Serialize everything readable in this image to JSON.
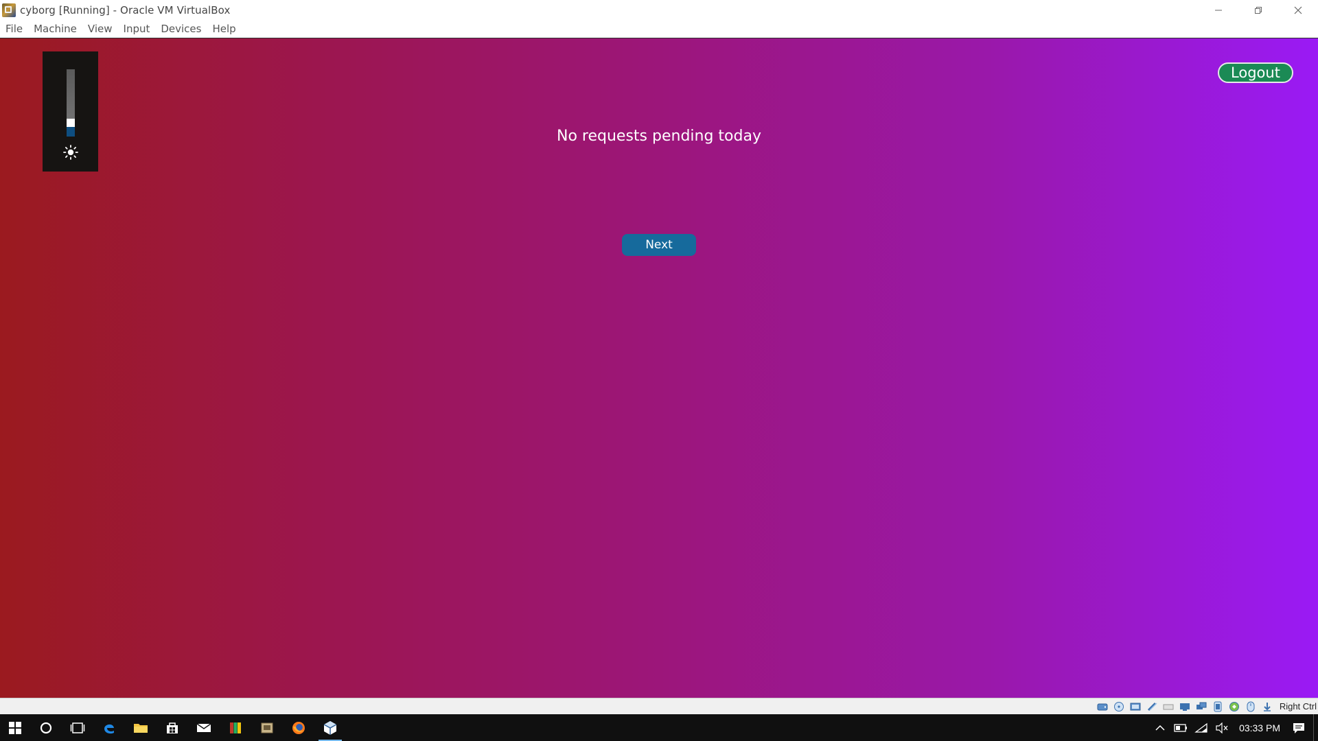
{
  "window": {
    "title": "cyborg [Running] - Oracle VM VirtualBox"
  },
  "menubar": {
    "items": [
      {
        "label": "File"
      },
      {
        "label": "Machine"
      },
      {
        "label": "View"
      },
      {
        "label": "Input"
      },
      {
        "label": "Devices"
      },
      {
        "label": "Help"
      }
    ]
  },
  "guest": {
    "brightness": {
      "level_fraction": 0.22,
      "icon": "sun-icon"
    },
    "logout_label": "Logout",
    "message": "No requests pending today",
    "next_label": "Next",
    "colors": {
      "gradient_start": "#9b1a1f",
      "gradient_end": "#9a1af5",
      "logout_bg": "#1b8a55",
      "next_bg": "#166a9c"
    }
  },
  "statusbar": {
    "host_key_label": "Right Ctrl",
    "icons": [
      "hard-disk-icon",
      "optical-drive-icon",
      "audio-icon",
      "network-icon",
      "usb-icon",
      "shared-folders-icon",
      "display-icon",
      "video-capture-icon",
      "cpu-icon",
      "mouse-integration-icon",
      "keyboard-capture-icon"
    ]
  },
  "taskbar": {
    "apps": [
      "start-icon",
      "cortana-icon",
      "task-view-icon",
      "edge-icon",
      "file-explorer-icon",
      "store-icon",
      "mail-icon",
      "winrar-icon",
      "generic-app-icon",
      "firefox-icon",
      "virtualbox-icon"
    ],
    "clock": "03:33 PM"
  }
}
